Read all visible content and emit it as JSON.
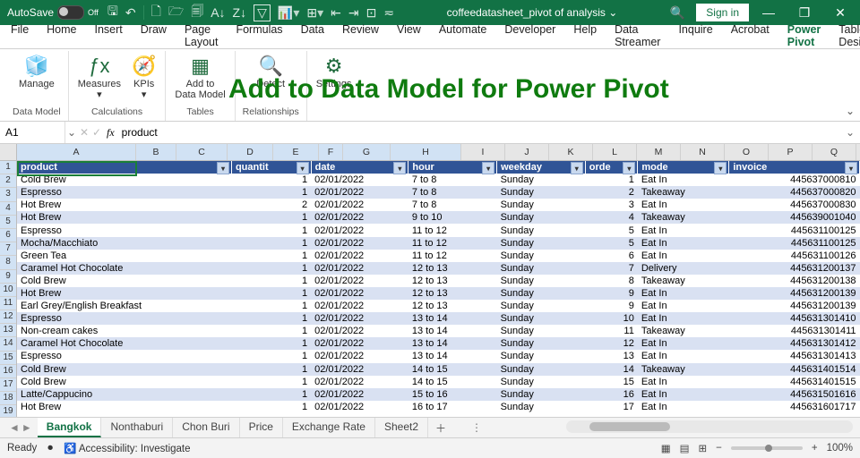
{
  "titlebar": {
    "autosave_label": "AutoSave",
    "autosave_state": "Off",
    "doc_title": "coffeedatasheet_pivot of analysis ⌄",
    "signin": "Sign in"
  },
  "menu": {
    "tabs": [
      "File",
      "Home",
      "Insert",
      "Draw",
      "Page Layout",
      "Formulas",
      "Data",
      "Review",
      "View",
      "Automate",
      "Developer",
      "Help",
      "Data Streamer",
      "Inquire",
      "Acrobat",
      "Power Pivot",
      "Table Design"
    ],
    "active": "Power Pivot"
  },
  "ribbon": {
    "groups": {
      "data_model": "Data Model",
      "calculations": "Calculations",
      "tables": "Tables",
      "relationships": "Relationships"
    },
    "buttons": {
      "manage": "Manage",
      "measures": "Measures",
      "kpis": "KPIs",
      "add_dm1": "Add to",
      "add_dm2": "Data Model",
      "detect": "Detect",
      "settings": "Settings"
    }
  },
  "annotation": "Add to Data Model for Power Pivot",
  "namebox": "A1",
  "formula": "product",
  "col_letters": [
    "A",
    "B",
    "C",
    "D",
    "E",
    "F",
    "G",
    "H",
    "I",
    "J",
    "K",
    "L",
    "M",
    "N",
    "O",
    "P",
    "Q"
  ],
  "headers": [
    "product",
    "quantity",
    "date",
    "hour",
    "weekday",
    "order",
    "mode",
    "invoice"
  ],
  "rows": [
    [
      "Cold Brew",
      "1",
      "02/01/2022",
      "7 to 8",
      "Sunday",
      "1",
      "Eat In",
      "445637000810"
    ],
    [
      "Espresso",
      "1",
      "02/01/2022",
      "7 to 8",
      "Sunday",
      "2",
      "Takeaway",
      "445637000820"
    ],
    [
      "Hot Brew",
      "2",
      "02/01/2022",
      "7 to 8",
      "Sunday",
      "3",
      "Eat In",
      "445637000830"
    ],
    [
      "Hot Brew",
      "1",
      "02/01/2022",
      "9 to 10",
      "Sunday",
      "4",
      "Takeaway",
      "445639001040"
    ],
    [
      "Espresso",
      "1",
      "02/01/2022",
      "11 to 12",
      "Sunday",
      "5",
      "Eat In",
      "445631100125"
    ],
    [
      "Mocha/Macchiato",
      "1",
      "02/01/2022",
      "11 to 12",
      "Sunday",
      "5",
      "Eat In",
      "445631100125"
    ],
    [
      "Green Tea",
      "1",
      "02/01/2022",
      "11 to 12",
      "Sunday",
      "6",
      "Eat In",
      "445631100126"
    ],
    [
      "Caramel Hot Chocolate",
      "1",
      "02/01/2022",
      "12 to 13",
      "Sunday",
      "7",
      "Delivery",
      "445631200137"
    ],
    [
      "Cold Brew",
      "1",
      "02/01/2022",
      "12 to 13",
      "Sunday",
      "8",
      "Takeaway",
      "445631200138"
    ],
    [
      "Hot Brew",
      "1",
      "02/01/2022",
      "12 to 13",
      "Sunday",
      "9",
      "Eat In",
      "445631200139"
    ],
    [
      "Earl Grey/English Breakfast",
      "1",
      "02/01/2022",
      "12 to 13",
      "Sunday",
      "9",
      "Eat In",
      "445631200139"
    ],
    [
      "Espresso",
      "1",
      "02/01/2022",
      "13 to 14",
      "Sunday",
      "10",
      "Eat In",
      "445631301410"
    ],
    [
      "Non-cream cakes",
      "1",
      "02/01/2022",
      "13 to 14",
      "Sunday",
      "11",
      "Takeaway",
      "445631301411"
    ],
    [
      "Caramel Hot Chocolate",
      "1",
      "02/01/2022",
      "13 to 14",
      "Sunday",
      "12",
      "Eat In",
      "445631301412"
    ],
    [
      "Espresso",
      "1",
      "02/01/2022",
      "13 to 14",
      "Sunday",
      "13",
      "Eat In",
      "445631301413"
    ],
    [
      "Cold Brew",
      "1",
      "02/01/2022",
      "14 to 15",
      "Sunday",
      "14",
      "Takeaway",
      "445631401514"
    ],
    [
      "Cold Brew",
      "1",
      "02/01/2022",
      "14 to 15",
      "Sunday",
      "15",
      "Eat In",
      "445631401515"
    ],
    [
      "Latte/Cappucino",
      "1",
      "02/01/2022",
      "15 to 16",
      "Sunday",
      "16",
      "Eat In",
      "445631501616"
    ],
    [
      "Hot Brew",
      "1",
      "02/01/2022",
      "16 to 17",
      "Sunday",
      "17",
      "Eat In",
      "445631601717"
    ]
  ],
  "sheet_tabs": [
    "Bangkok",
    "Nonthaburi",
    "Chon Buri",
    "Price",
    "Exchange Rate",
    "Sheet2"
  ],
  "active_sheet": "Bangkok",
  "status": {
    "ready": "Ready",
    "acc": "Accessibility: Investigate",
    "zoom": "100%"
  }
}
